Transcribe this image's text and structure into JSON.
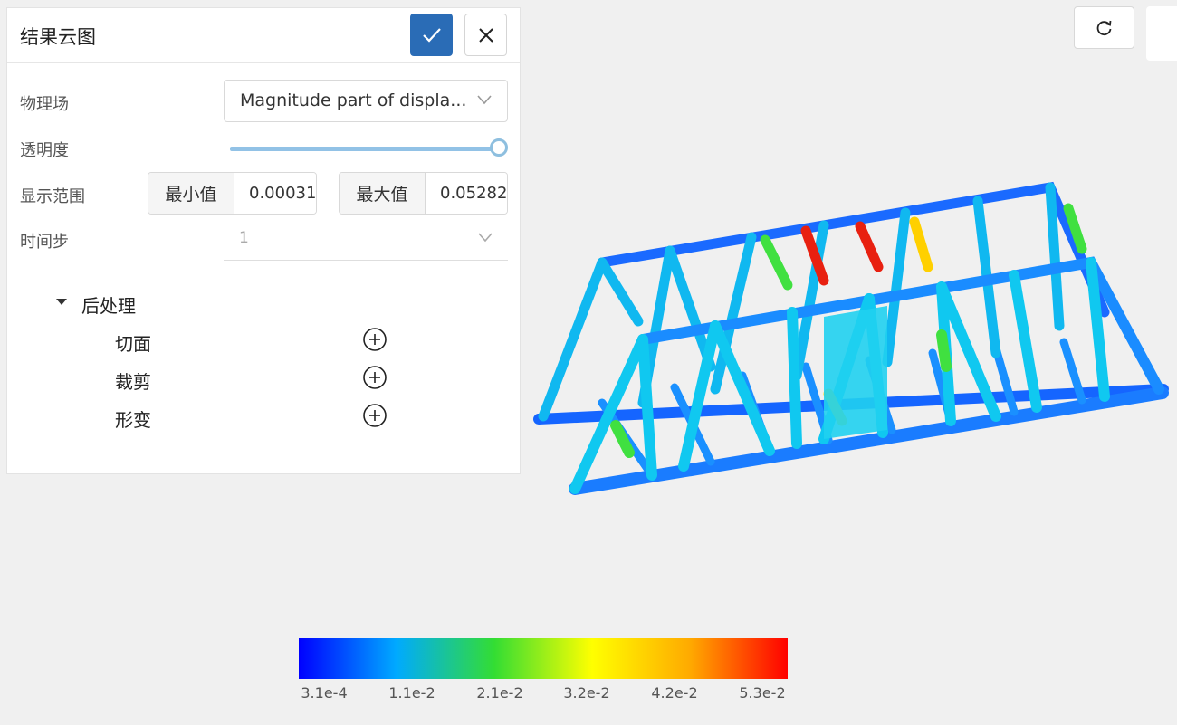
{
  "panel": {
    "title": "结果云图",
    "confirm_icon": "check-icon",
    "close_icon": "close-icon",
    "field_label": "物理场",
    "field_value": "Magnitude part of displa...",
    "opacity_label": "透明度",
    "opacity_value": 1.0,
    "range_label": "显示范围",
    "min_label": "最小值",
    "min_value": "0.00031",
    "max_label": "最大值",
    "max_value": "0.05282",
    "timestep_label": "时间步",
    "timestep_value": "1",
    "post_processing": {
      "root": "后处理",
      "items": [
        {
          "label": "切面",
          "icon": "add-circle-icon"
        },
        {
          "label": "裁剪",
          "icon": "add-circle-icon"
        },
        {
          "label": "形变",
          "icon": "add-circle-icon"
        }
      ]
    }
  },
  "toolbar": {
    "reset_icon": "reset-view-icon"
  },
  "colorbar": {
    "ticks": [
      "3.1e-4",
      "1.1e-2",
      "2.1e-2",
      "3.2e-2",
      "4.2e-2",
      "5.3e-2"
    ],
    "colors": [
      "#0000ff",
      "#00aaff",
      "#33dd33",
      "#ffff00",
      "#ffaa00",
      "#ff0000"
    ]
  },
  "colors": {
    "accent": "#2a6cb6",
    "slider": "#92c2e6"
  }
}
